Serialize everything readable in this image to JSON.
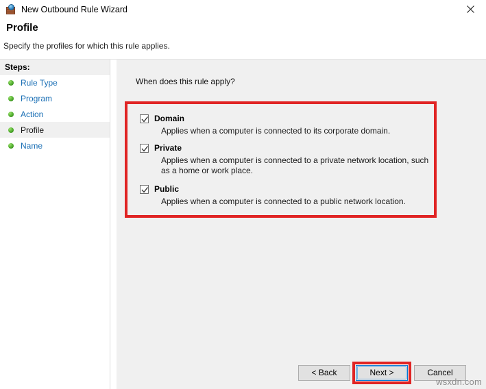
{
  "window": {
    "title": "New Outbound Rule Wizard",
    "icon": "firewall-globe-icon",
    "close_label": "✕"
  },
  "header": {
    "title": "Profile",
    "subtitle": "Specify the profiles for which this rule applies."
  },
  "sidebar": {
    "heading": "Steps:",
    "items": [
      {
        "label": "Rule Type",
        "current": false
      },
      {
        "label": "Program",
        "current": false
      },
      {
        "label": "Action",
        "current": false
      },
      {
        "label": "Profile",
        "current": true
      },
      {
        "label": "Name",
        "current": false
      }
    ]
  },
  "main": {
    "question": "When does this rule apply?",
    "profiles": [
      {
        "name": "Domain",
        "description": "Applies when a computer is connected to its corporate domain.",
        "checked": true
      },
      {
        "name": "Private",
        "description": "Applies when a computer is connected to a private network location, such as a home or work place.",
        "checked": true
      },
      {
        "name": "Public",
        "description": "Applies when a computer is connected to a public network location.",
        "checked": true
      }
    ]
  },
  "footer": {
    "back_label": "< Back",
    "next_label": "Next >",
    "cancel_label": "Cancel"
  },
  "watermark": "wsxdn.com",
  "colors": {
    "highlight_red": "#e02424",
    "link_blue": "#1a6fb5",
    "panel_gray": "#f0f0f0",
    "focus_blue": "#0078d7"
  }
}
